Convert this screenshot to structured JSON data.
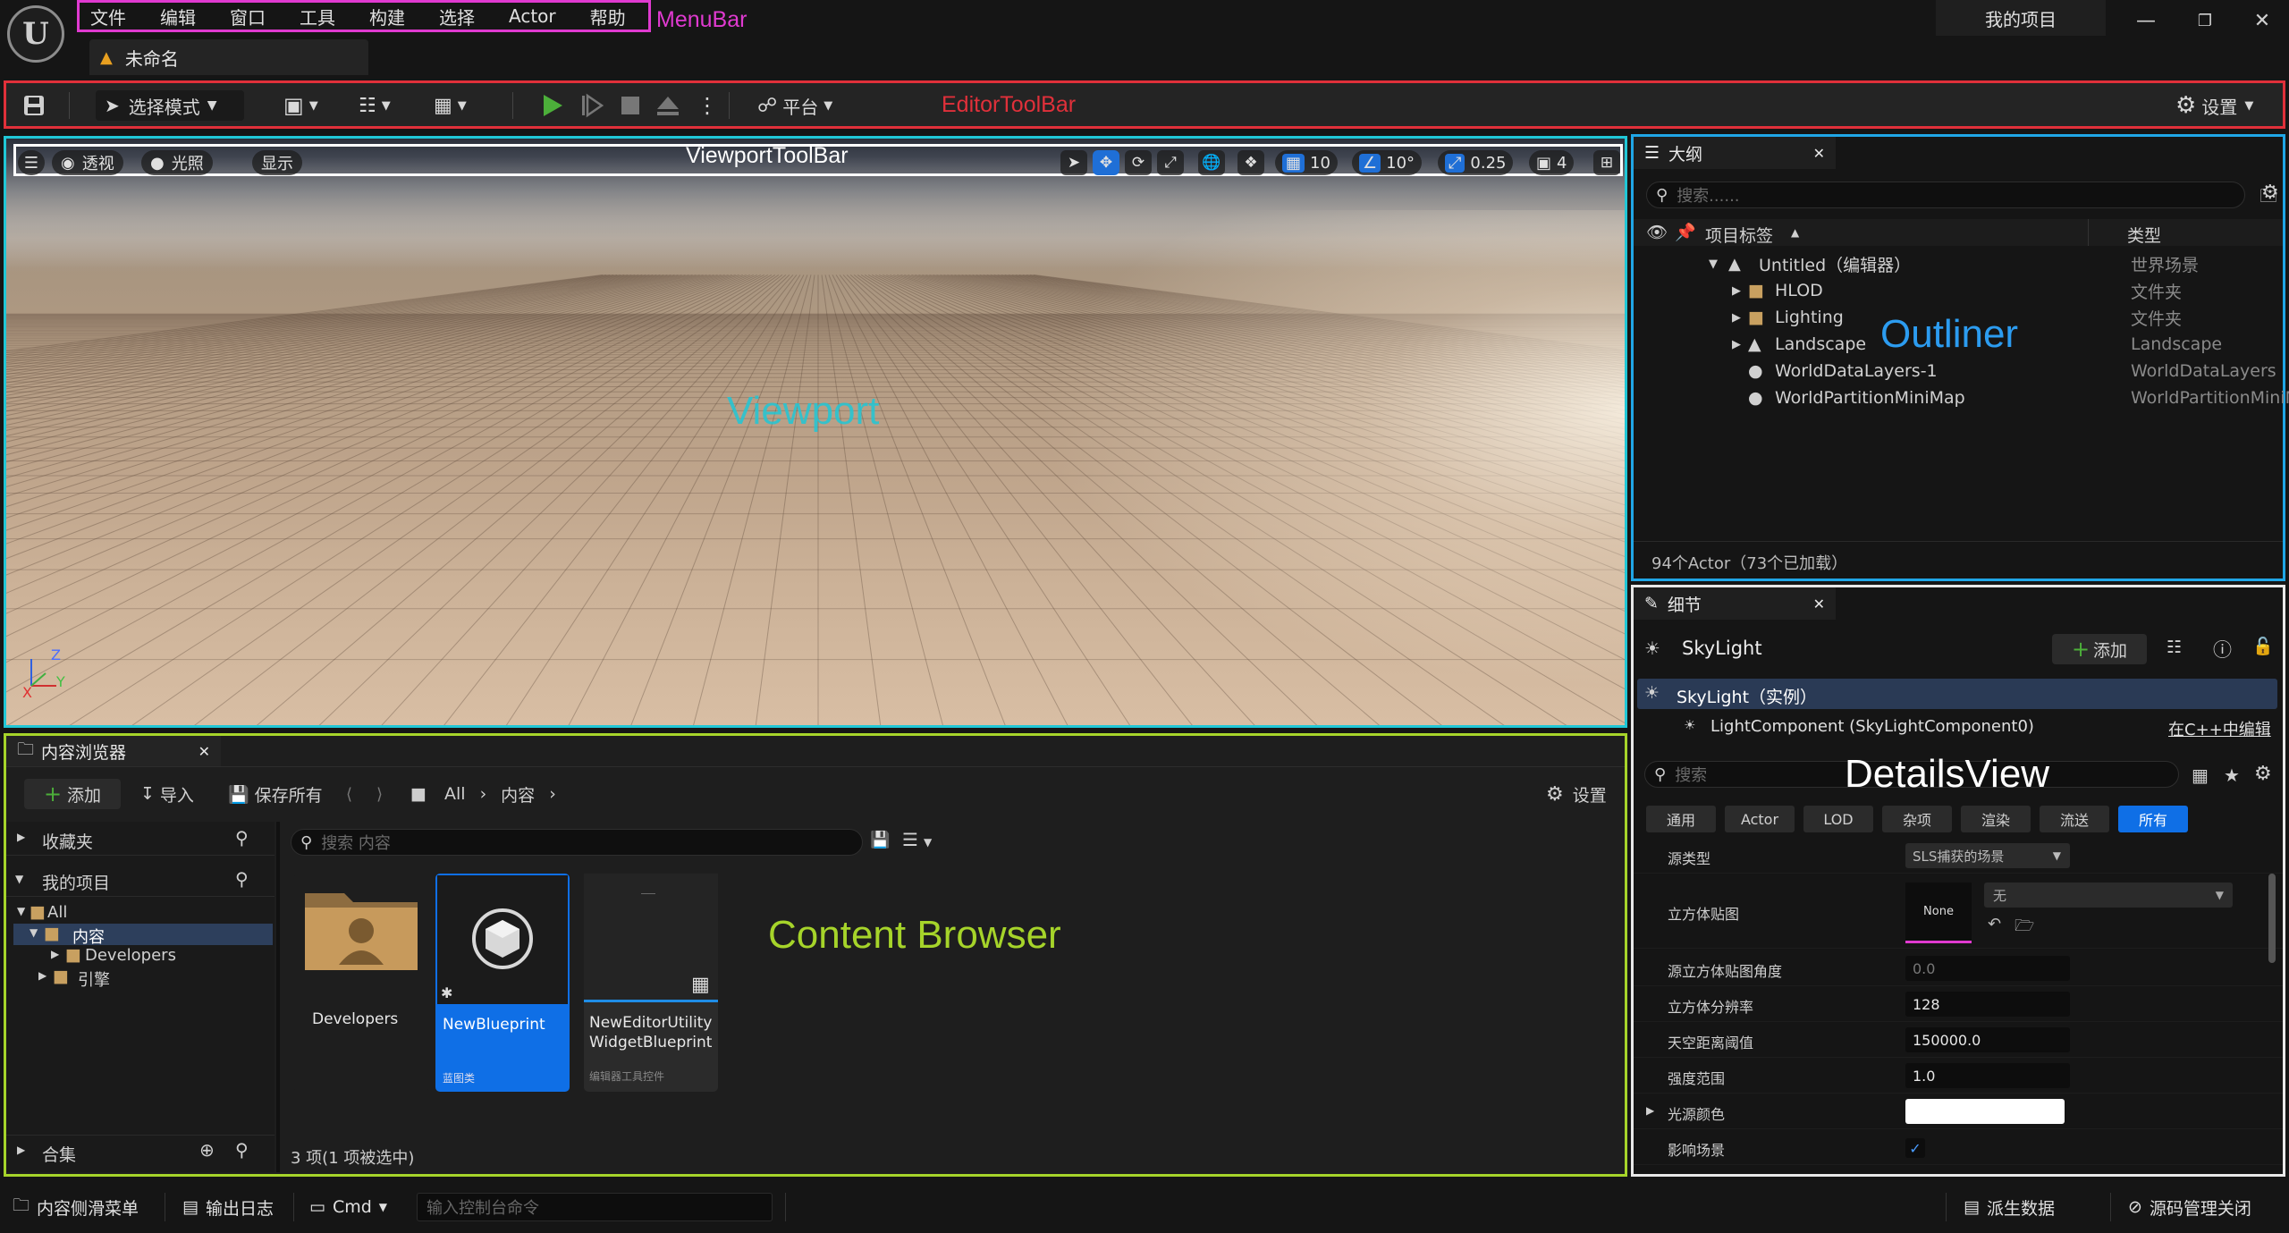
{
  "menubar": {
    "items": [
      "文件",
      "编辑",
      "窗口",
      "工具",
      "构建",
      "选择",
      "Actor",
      "帮助"
    ],
    "annotation": "MenuBar"
  },
  "window": {
    "project_name": "我的项目",
    "level_tab": "未命名"
  },
  "toolbar": {
    "mode_label": "选择模式",
    "platform_label": "平台",
    "settings_label": "设置",
    "annotation": "EditorToolBar"
  },
  "viewport": {
    "view_mode": "透视",
    "lit_mode": "光照",
    "show_label": "显示",
    "grid_snap": "10",
    "rotate_snap": "10°",
    "scale_snap": "0.25",
    "camera_speed": "4",
    "toolbar_annotation": "ViewportToolBar",
    "annotation": "Viewport",
    "axis_z": "Z",
    "axis_y": "Y",
    "axis_x": "X"
  },
  "outliner": {
    "tab_label": "大纲",
    "search_placeholder": "搜索......",
    "col_label": "项目标签",
    "col_type": "类型",
    "rows": [
      {
        "label": "Untitled（编辑器）",
        "type": "世界场景"
      },
      {
        "label": "HLOD",
        "type": "文件夹"
      },
      {
        "label": "Lighting",
        "type": "文件夹"
      },
      {
        "label": "Landscape",
        "type": "Landscape"
      },
      {
        "label": "WorldDataLayers-1",
        "type": "WorldDataLayers"
      },
      {
        "label": "WorldPartitionMiniMap",
        "type": "WorldPartitionMiniM"
      }
    ],
    "footer": "94个Actor（73个已加载）",
    "annotation": "Outliner"
  },
  "details": {
    "tab_label": "细节",
    "actor_name": "SkyLight",
    "add_label": "添加",
    "instance_label": "SkyLight（实例）",
    "component_label": "LightComponent (SkyLightComponent0)",
    "edit_cpp": "在C++中编辑",
    "search_placeholder": "搜索",
    "annotation": "DetailsView",
    "categories": [
      "通用",
      "Actor",
      "LOD",
      "杂项",
      "渲染",
      "流送",
      "所有"
    ],
    "props": {
      "source_type": {
        "label": "源类型",
        "value": "SLS捕获的场景"
      },
      "cubemap": {
        "label": "立方体贴图",
        "value": "None",
        "asset": "无"
      },
      "cubemap_angle": {
        "label": "源立方体贴图角度",
        "value": "0.0"
      },
      "cubemap_res": {
        "label": "立方体分辨率",
        "value": "128"
      },
      "sky_distance": {
        "label": "天空距离阈值",
        "value": "150000.0"
      },
      "intensity": {
        "label": "强度范围",
        "value": "1.0"
      },
      "light_color": {
        "label": "光源颜色",
        "color": "#ffffff"
      },
      "affects_world": {
        "label": "影响场景",
        "checked": true
      }
    }
  },
  "content_browser": {
    "tab_label": "内容浏览器",
    "add_label": "添加",
    "import_label": "导入",
    "save_all_label": "保存所有",
    "path": [
      "All",
      "内容"
    ],
    "settings_label": "设置",
    "favorites_label": "收藏夹",
    "project_label": "我的项目",
    "tree": [
      "All",
      "内容",
      "Developers",
      "引擎"
    ],
    "collections_label": "合集",
    "search_placeholder": "搜索 内容",
    "assets": [
      {
        "name": "Developers",
        "subtype": ""
      },
      {
        "name": "NewBlueprint",
        "subtype": "蓝图类"
      },
      {
        "name": "NewEditorUtility WidgetBlueprint",
        "subtype": "编辑器工具控件"
      }
    ],
    "status": "3 项(1 项被选中)",
    "annotation": "Content Browser"
  },
  "statusbar": {
    "drawer_label": "内容侧滑菜单",
    "output_log_label": "输出日志",
    "cmd_label": "Cmd",
    "console_placeholder": "输入控制台命令",
    "derived_data_label": "派生数据",
    "source_control_label": "源码管理关闭"
  },
  "colors": {
    "menubar_outline": "#e03ad0",
    "toolbar_outline": "#e0303a",
    "viewport_outline": "#20c7d6",
    "outliner_outline": "#20a6e6",
    "details_outline": "#e8e8e8",
    "content_outline": "#a6d42a",
    "selection_blue": "#0f6fe6"
  }
}
